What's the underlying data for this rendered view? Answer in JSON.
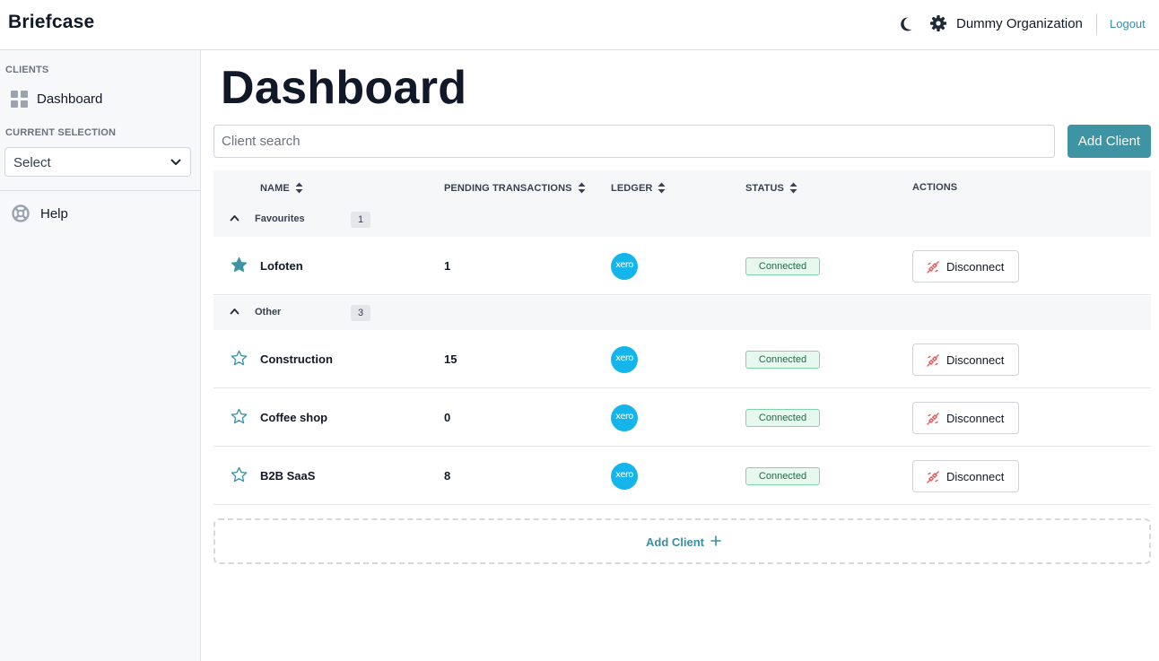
{
  "header": {
    "brand": "Briefcase",
    "organization": "Dummy Organization",
    "logout_label": "Logout"
  },
  "sidebar": {
    "clients_section": "CLIENTS",
    "dashboard_label": "Dashboard",
    "current_selection_section": "CURRENT SELECTION",
    "select_value": "Select",
    "help_label": "Help"
  },
  "main": {
    "title": "Dashboard",
    "search_placeholder": "Client search",
    "add_client_label": "Add Client",
    "columns": [
      "NAME",
      "PENDING TRANSACTIONS",
      "LEDGER",
      "STATUS",
      "ACTIONS"
    ],
    "groups": [
      {
        "label": "Favourites",
        "count": "1",
        "rows": [
          {
            "name": "Lofoten",
            "pending": "1",
            "ledger": "xero",
            "status": "Connected",
            "action": "Disconnect",
            "favourite": true
          }
        ]
      },
      {
        "label": "Other",
        "count": "3",
        "rows": [
          {
            "name": "Construction",
            "pending": "15",
            "ledger": "xero",
            "status": "Connected",
            "action": "Disconnect",
            "favourite": false
          },
          {
            "name": "Coffee shop",
            "pending": "0",
            "ledger": "xero",
            "status": "Connected",
            "action": "Disconnect",
            "favourite": false
          },
          {
            "name": "B2B SaaS",
            "pending": "8",
            "ledger": "xero",
            "status": "Connected",
            "action": "Disconnect",
            "favourite": false
          }
        ]
      }
    ],
    "add_client_row_label": "Add Client"
  },
  "colors": {
    "accent": "#3f94a4",
    "link": "#3b8fa0",
    "xero": "#13b5ea",
    "status_bg": "#e7f8ef",
    "status_border": "#7fd4a8",
    "disconnect_icon": "#e45a5a"
  },
  "icons": {
    "theme_toggle": "moon-icon",
    "settings": "gear-icon",
    "dashboard": "grid-icon",
    "select_caret": "chevron-down-icon",
    "help": "lifebuoy-icon",
    "sort": "sort-icon",
    "group_toggle": "chevron-up-icon",
    "favourite_on": "star-filled-icon",
    "favourite_off": "star-outline-icon",
    "ledger": "xero-logo",
    "disconnect": "unplug-icon",
    "add": "plus-icon"
  }
}
